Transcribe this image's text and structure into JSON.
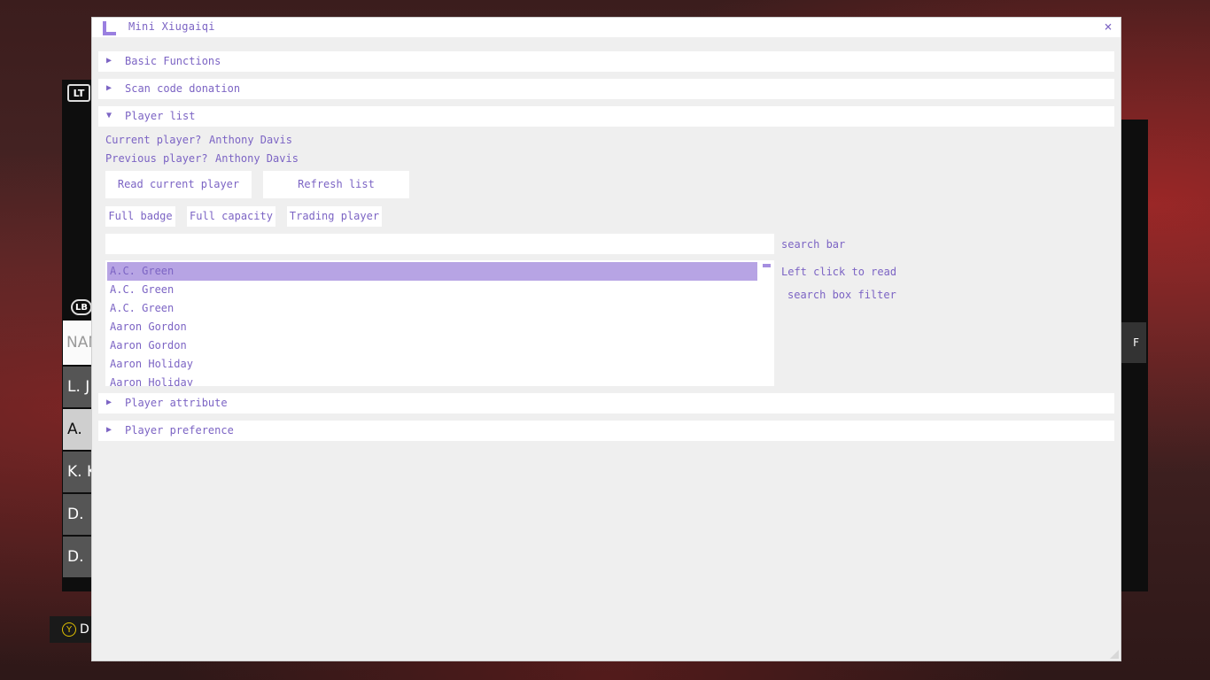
{
  "window": {
    "title": "Mini Xiugaiqi",
    "close_glyph": "×",
    "accent_color": "#7c64c4",
    "selection_color": "#b7a4e4"
  },
  "sections": [
    {
      "arrow": "▶",
      "label": "Basic Functions",
      "expanded": false
    },
    {
      "arrow": "▶",
      "label": "Scan code donation",
      "expanded": false
    },
    {
      "arrow": "▼",
      "label": "Player list",
      "expanded": true
    },
    {
      "arrow": "▶",
      "label": "Player attribute",
      "expanded": false
    },
    {
      "arrow": "▶",
      "label": "Player preference",
      "expanded": false
    }
  ],
  "player_list": {
    "current_label": "Current player?",
    "current_value": "Anthony Davis",
    "previous_label": "Previous player?",
    "previous_value": "Anthony Davis",
    "buttons": {
      "read_current": "Read current player",
      "refresh": "Refresh list",
      "full_badge": "Full badge",
      "full_capacity": "Full capacity",
      "trading_player": "Trading player"
    },
    "search_value": "",
    "search_label": "search bar",
    "hint_left_click": "Left click to read",
    "hint_filter": "search box filter",
    "items": [
      "A.C. Green",
      "A.C. Green",
      "A.C. Green",
      "Aaron Gordon",
      "Aaron Gordon",
      "Aaron Holiday",
      "Aaron Holiday"
    ],
    "selected_index": 0
  },
  "background": {
    "lt": "LT",
    "lb": "LB",
    "name_header": "NAME",
    "rows": [
      "L. J",
      "A. D",
      "K. K",
      "D. C",
      "D. H"
    ],
    "right_header": "F",
    "bottom_button": "Y",
    "bottom_label": "D"
  }
}
